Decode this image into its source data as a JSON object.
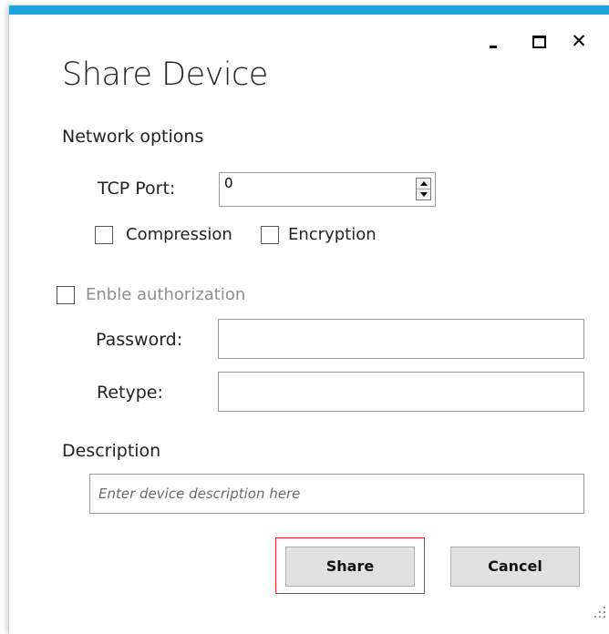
{
  "window": {
    "title": "Share Device",
    "accent_color": "#1aa3dc",
    "controls": {
      "minimize_icon": "minimize-icon",
      "maximize_icon": "maximize-icon",
      "close_icon": "close-icon",
      "close_glyph": "✕"
    }
  },
  "network": {
    "section_label": "Network options",
    "tcp_port_label": "TCP Port:",
    "tcp_port_value": "0",
    "compression_label": "Compression",
    "compression_checked": false,
    "encryption_label": "Encryption",
    "encryption_checked": false
  },
  "auth": {
    "enable_label": "Enble authorization",
    "enable_checked": false,
    "password_label": "Password:",
    "password_value": "",
    "retype_label": "Retype:",
    "retype_value": ""
  },
  "description": {
    "label": "Description",
    "value": "",
    "placeholder": "Enter device description here"
  },
  "actions": {
    "share_label": "Share",
    "cancel_label": "Cancel",
    "highlight_color": "#e0262d"
  }
}
